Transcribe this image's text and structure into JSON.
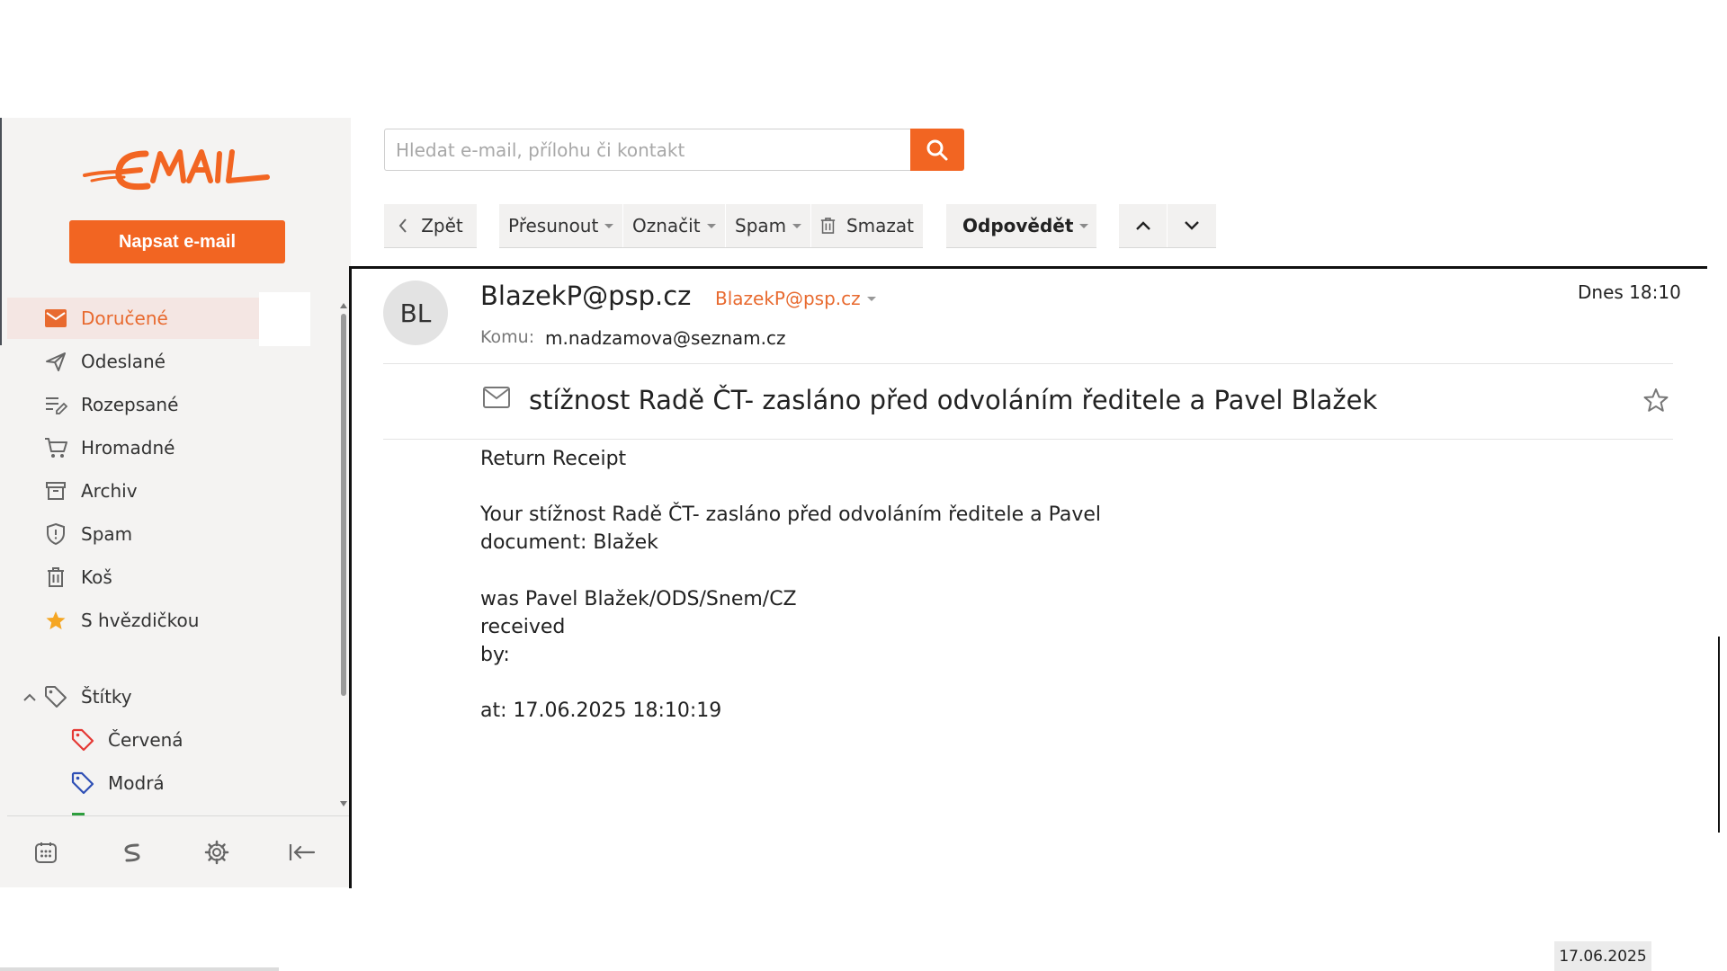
{
  "brand": {
    "logo_text": "EMAIL",
    "accent": "#f26522"
  },
  "sidebar": {
    "compose_label": "Napsat e-mail",
    "folders": [
      {
        "label": "Doručené",
        "icon": "inbox-icon",
        "active": true
      },
      {
        "label": "Odeslané",
        "icon": "send-icon"
      },
      {
        "label": "Rozepsané",
        "icon": "drafts-icon"
      },
      {
        "label": "Hromadné",
        "icon": "cart-icon"
      },
      {
        "label": "Archiv",
        "icon": "archive-icon"
      },
      {
        "label": "Spam",
        "icon": "shield-icon"
      },
      {
        "label": "Koš",
        "icon": "trash-icon"
      },
      {
        "label": "S hvězdičkou",
        "icon": "star-icon"
      }
    ],
    "labels_header": "Štítky",
    "labels": [
      {
        "label": "Červená",
        "color": "#e53935"
      },
      {
        "label": "Modrá",
        "color": "#2e4fb5"
      }
    ],
    "bottom_icons": [
      "calendar-icon",
      "seznam-icon",
      "settings-icon",
      "collapse-icon"
    ]
  },
  "search": {
    "placeholder": "Hledat e-mail, přílohu či kontakt",
    "value": ""
  },
  "toolbar": {
    "back": "Zpět",
    "move": "Přesunout",
    "mark": "Označit",
    "spam": "Spam",
    "delete": "Smazat",
    "reply": "Odpovědět"
  },
  "message": {
    "avatar_initials": "BL",
    "sender_name": "BlazekP@psp.cz",
    "sender_address": "BlazekP@psp.cz",
    "date": "Dnes 18:10",
    "to_label": "Komu:",
    "to_value": "m.nadzamova@seznam.cz",
    "subject": "stížnost Radě ČT- zasláno před odvoláním ředitele a Pavel Blažek",
    "body_lines": [
      "Return Receipt",
      "",
      "Your stížnost Radě ČT- zasláno před odvoláním ředitele a Pavel",
      "document: Blažek",
      "",
      "was Pavel Blažek/ODS/Snem/CZ",
      "received",
      "by:",
      "",
      "at: 17.06.2025 18:10:19"
    ]
  },
  "taskbar": {
    "date": "17.06.2025"
  }
}
